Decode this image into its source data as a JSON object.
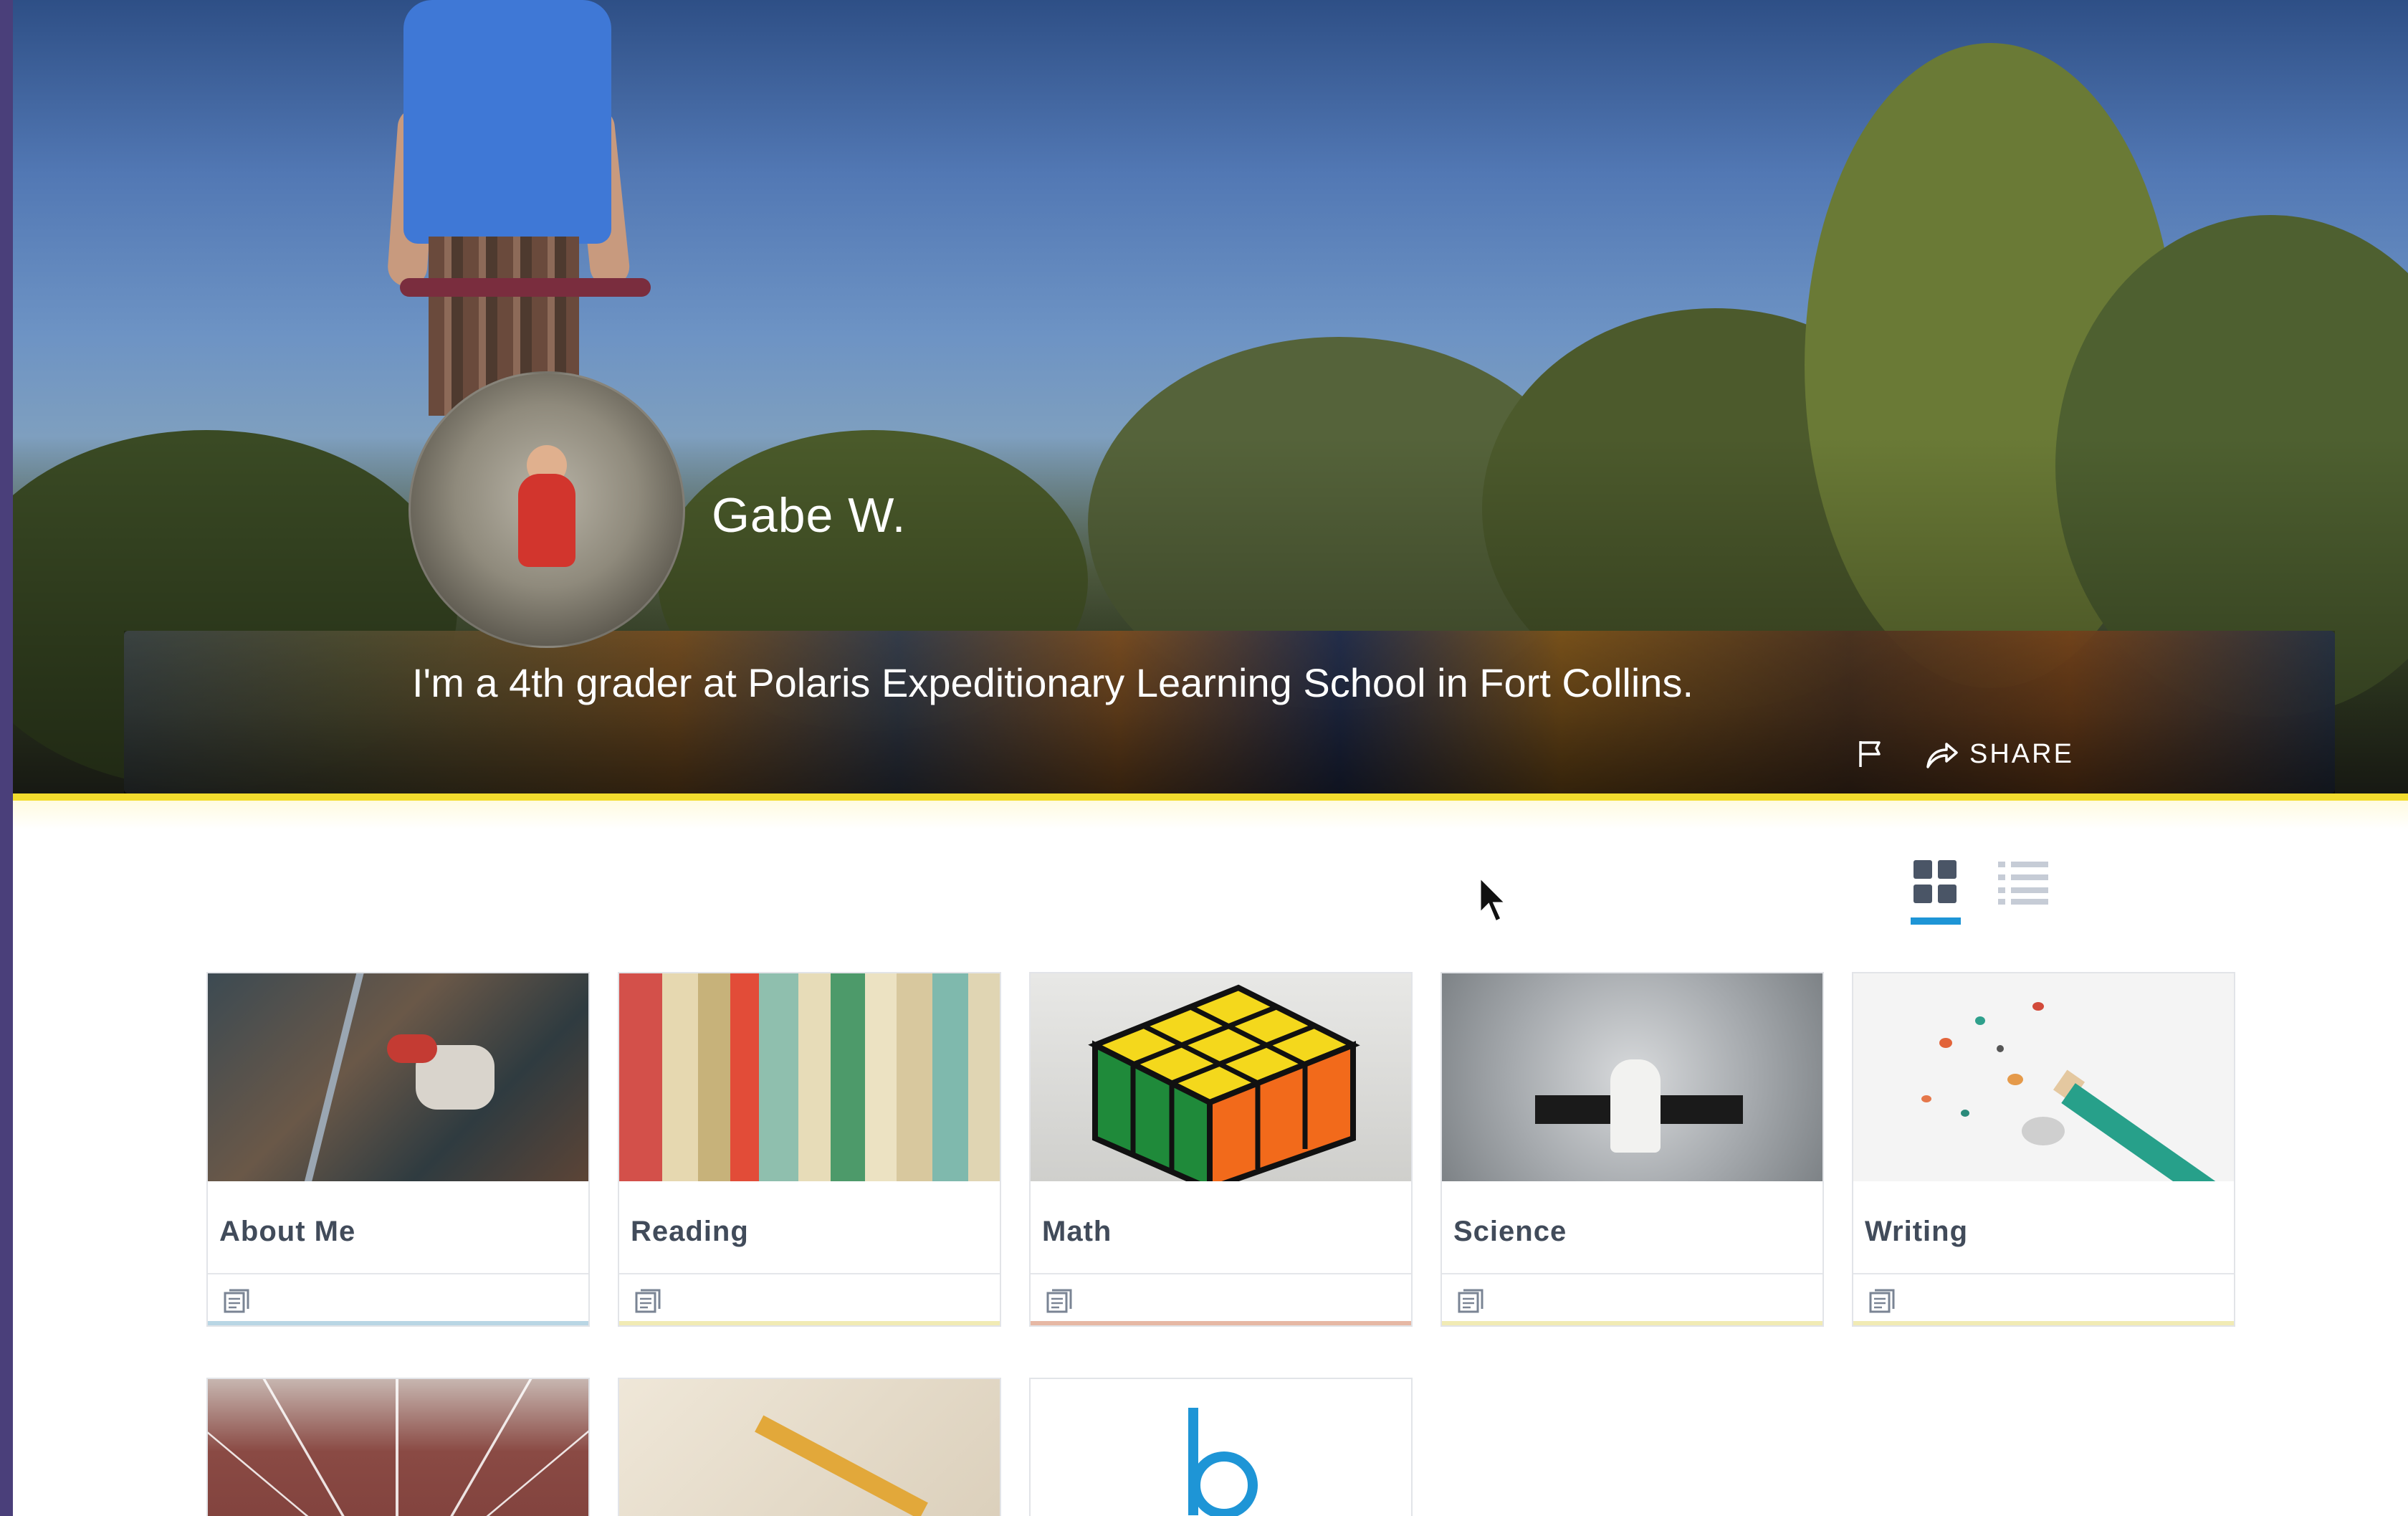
{
  "profile": {
    "name": "Gabe W.",
    "bio": "I'm a 4th grader at Polaris Expeditionary Learning School in Fort Collins.",
    "share_label": "SHARE"
  },
  "icons": {
    "flag": "flag-icon",
    "share": "share-icon",
    "grid_view": "grid-view-icon",
    "list_view": "list-view-icon",
    "pages": "pages-icon"
  },
  "view": {
    "selected": "grid"
  },
  "colors": {
    "accent_yellow": "#f2dc2e",
    "accent_blue": "#1e95d6",
    "title_text": "#414b5a"
  },
  "cards": [
    {
      "title": "About Me",
      "accent": "#b9d6e4"
    },
    {
      "title": "Reading",
      "accent": "#f1ebb4"
    },
    {
      "title": "Math",
      "accent": "#e6b8a4"
    },
    {
      "title": "Science",
      "accent": "#f1ebb4"
    },
    {
      "title": "Writing",
      "accent": "#f1ebb4"
    }
  ]
}
